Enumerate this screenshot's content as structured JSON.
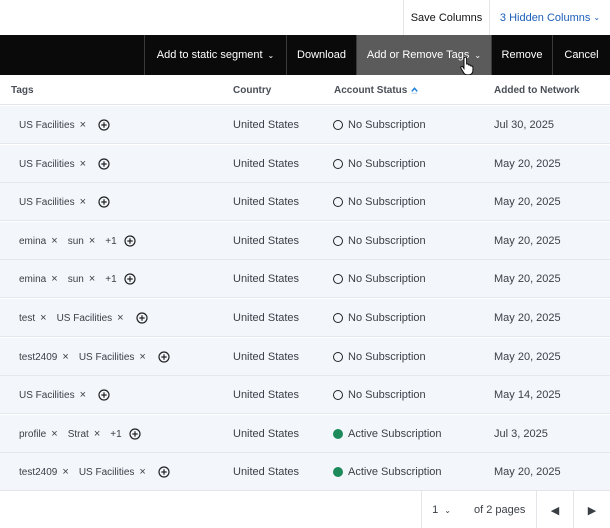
{
  "toolbar": {
    "save_columns": "Save Columns",
    "hidden_columns": "3 Hidden Columns"
  },
  "actions": {
    "add_to_segment": "Add to static segment",
    "download": "Download",
    "add_remove_tags": "Add or Remove Tags",
    "remove": "Remove",
    "cancel": "Cancel"
  },
  "table": {
    "headers": {
      "tags": "Tags",
      "country": "Country",
      "status": "Account Status",
      "added": "Added to Network"
    },
    "rows": [
      {
        "tags": [
          "US Facilities"
        ],
        "more": "",
        "country": "United States",
        "status": "No Subscription",
        "status_type": "none",
        "added": "Jul 30, 2025"
      },
      {
        "tags": [
          "US Facilities"
        ],
        "more": "",
        "country": "United States",
        "status": "No Subscription",
        "status_type": "none",
        "added": "May 20, 2025"
      },
      {
        "tags": [
          "US Facilities"
        ],
        "more": "",
        "country": "United States",
        "status": "No Subscription",
        "status_type": "none",
        "added": "May 20, 2025"
      },
      {
        "tags": [
          "emina",
          "sun"
        ],
        "more": "+1",
        "country": "United States",
        "status": "No Subscription",
        "status_type": "none",
        "added": "May 20, 2025"
      },
      {
        "tags": [
          "emina",
          "sun"
        ],
        "more": "+1",
        "country": "United States",
        "status": "No Subscription",
        "status_type": "none",
        "added": "May 20, 2025"
      },
      {
        "tags": [
          "test",
          "US Facilities"
        ],
        "more": "",
        "country": "United States",
        "status": "No Subscription",
        "status_type": "none",
        "added": "May 20, 2025"
      },
      {
        "tags": [
          "test2409",
          "US Facilities"
        ],
        "more": "",
        "country": "United States",
        "status": "No Subscription",
        "status_type": "none",
        "added": "May 20, 2025"
      },
      {
        "tags": [
          "US Facilities"
        ],
        "more": "",
        "country": "United States",
        "status": "No Subscription",
        "status_type": "none",
        "added": "May 14, 2025"
      },
      {
        "tags": [
          "profile",
          "Strat"
        ],
        "more": "+1",
        "country": "United States",
        "status": "Active Subscription",
        "status_type": "active",
        "added": "Jul 3, 2025"
      },
      {
        "tags": [
          "test2409",
          "US Facilities"
        ],
        "more": "",
        "country": "United States",
        "status": "Active Subscription",
        "status_type": "active",
        "added": "May 20, 2025"
      }
    ]
  },
  "pagination": {
    "current_page": "1",
    "of_pages": "of 2 pages"
  },
  "colors": {
    "action_bar": "#0a0a0a",
    "active_button": "#5b5b5b",
    "link_blue": "#1c5fb8",
    "active_status": "#1c8a5a",
    "row_background": "#f3f7fc"
  },
  "icons": {
    "remove_tag": "close-icon",
    "add_tag": "plus-circle-icon",
    "sort": "sort-ascending-icon",
    "dropdown": "chevron-down-icon",
    "prev": "caret-left-icon",
    "next": "caret-right-icon"
  }
}
